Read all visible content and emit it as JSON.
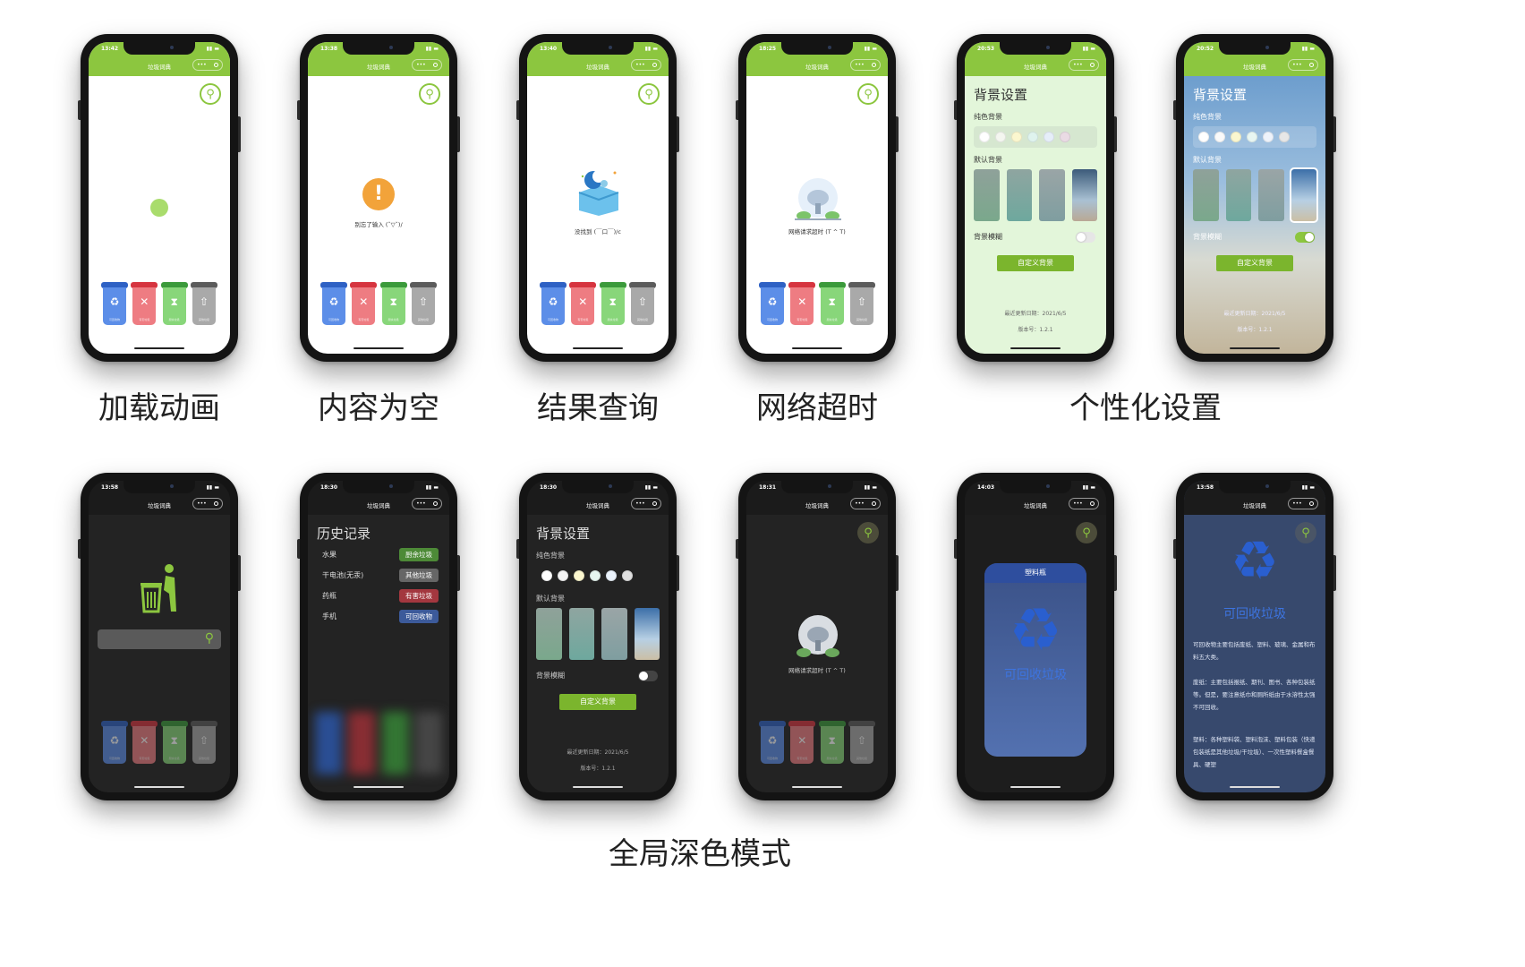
{
  "app_title": "垃圾词典",
  "captions": {
    "loading": "加载动画",
    "empty": "内容为空",
    "result": "结果查询",
    "timeout": "网络超时",
    "personalize": "个性化设置",
    "dark_mode": "全局深色模式"
  },
  "times": [
    "13:42",
    "13:38",
    "13:40",
    "18:25",
    "20:53",
    "20:52",
    "13:58",
    "18:30",
    "18:30",
    "18:31",
    "14:03",
    "13:58"
  ],
  "messages": {
    "empty": "别忘了输入 (ˇ▽ˇ)/",
    "not_found": "没找到 (￣口￣)/c",
    "timeout": "网络请求超时 (T ^ T)"
  },
  "bins": [
    {
      "icon": "recycle-icon",
      "label": "可回收物",
      "color": "#2e61c4"
    },
    {
      "icon": "hazard-icon",
      "label": "有害垃圾",
      "color": "#d6343f"
    },
    {
      "icon": "hourglass-icon",
      "label": "厨余垃圾",
      "color": "#3b9a3b"
    },
    {
      "icon": "other-waste-icon",
      "label": "其他垃圾",
      "color": "#5c5c5c"
    }
  ],
  "settings": {
    "title": "背景设置",
    "solid_bg": "纯色背景",
    "default_bg": "默认背景",
    "blur": "背景模糊",
    "custom_button": "自定义背景",
    "update_date": "最近更新日期：2021/6/5",
    "version": "版本号：1.2.1"
  },
  "history": {
    "title": "历史记录",
    "items": [
      {
        "name": "水果",
        "tag": "厨余垃圾",
        "color": "#4d8a37"
      },
      {
        "name": "干电池(无汞)",
        "tag": "其他垃圾",
        "color": "#666666"
      },
      {
        "name": "药瓶",
        "tag": "有害垃圾",
        "color": "#a3373f"
      },
      {
        "name": "手机",
        "tag": "可回收物",
        "color": "#3c5a9a"
      }
    ]
  },
  "detail": {
    "card_header": "塑料瓶",
    "card_title": "可回收垃圾",
    "heading": "可回收垃圾",
    "p1": "可回收物主要包括废纸、塑料、玻璃、金属和布料五大类。",
    "p2": "废纸：主要包括报纸、期刊、图书、各种包装纸等。但是，要注意纸巾和厕所纸由于水溶性太强不可回收。",
    "p3": "塑料：各种塑料袋、塑料泡沫、塑料包装（快递包装纸是其他垃圾/干垃圾）、一次性塑料餐盒餐具、硬塑"
  }
}
